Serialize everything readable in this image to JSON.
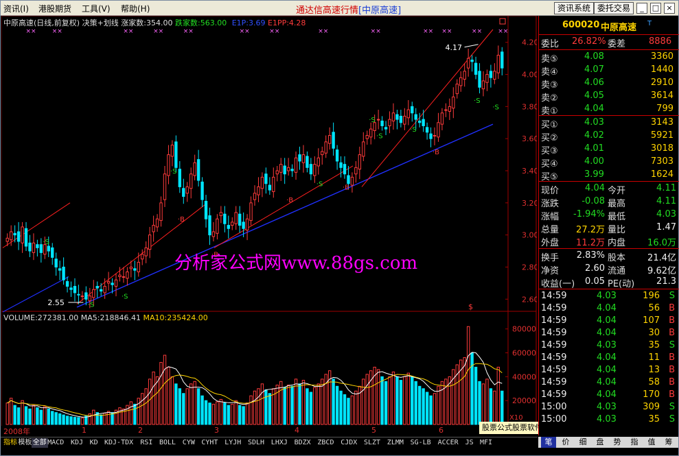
{
  "menu": {
    "items": [
      "资讯(I)",
      "港股期货",
      "工具(V)",
      "帮助(H)"
    ],
    "title": "通达信高速行情",
    "subtitle": "[中原高速]",
    "btn_info": "资讯系统",
    "btn_order": "委托交易",
    "win_min": "_",
    "win_max": "□",
    "win_close": "×"
  },
  "chart_header": {
    "name": "中原高速(日线,前复权)",
    "indicator": "决策+划线",
    "up_count": "涨家数:354.00",
    "down_count": "跌家数:563.00",
    "e1p": "E1P:3.69",
    "e1pp": "E1PP:4.28"
  },
  "volume_header": {
    "volume": "VOLUME:272381.00",
    "ma5": "MA5:218846.41",
    "ma10": "MA10:235424.00"
  },
  "annotations": {
    "high_label": "4.17",
    "low_label": "2.55",
    "watermark": "分析家公式网www.88gs.com",
    "x10": "X10",
    "dollar": "$"
  },
  "timeline": {
    "year": "2008年",
    "months": [
      "1",
      "2",
      "3",
      "4",
      "5",
      "6"
    ]
  },
  "quote": {
    "code": "600020",
    "name": "中原高速",
    "t_mark": "T",
    "weibi_label": "委比",
    "weibi_value": "26.82%",
    "weicha_label": "委差",
    "weicha_value": "8886",
    "sells": [
      {
        "label": "卖⑤",
        "price": "4.08",
        "vol": "3360"
      },
      {
        "label": "卖④",
        "price": "4.07",
        "vol": "1440"
      },
      {
        "label": "卖③",
        "price": "4.06",
        "vol": "2910"
      },
      {
        "label": "卖②",
        "price": "4.05",
        "vol": "3614"
      },
      {
        "label": "卖①",
        "price": "4.04",
        "vol": "799"
      }
    ],
    "buys": [
      {
        "label": "买①",
        "price": "4.03",
        "vol": "3143"
      },
      {
        "label": "买②",
        "price": "4.02",
        "vol": "5921"
      },
      {
        "label": "买③",
        "price": "4.01",
        "vol": "3018"
      },
      {
        "label": "买④",
        "price": "4.00",
        "vol": "7303"
      },
      {
        "label": "买⑤",
        "price": "3.99",
        "vol": "1624"
      }
    ],
    "stats": [
      {
        "l1": "现价",
        "v1": "4.04",
        "l2": "今开",
        "v2": "4.11"
      },
      {
        "l1": "涨跌",
        "v1": "-0.08",
        "l2": "最高",
        "v2": "4.11"
      },
      {
        "l1": "涨幅",
        "v1": "-1.94%",
        "l2": "最低",
        "v2": "4.03"
      },
      {
        "l1": "总量",
        "v1": "27.2万",
        "l2": "量比",
        "v2": "1.47"
      },
      {
        "l1": "外盘",
        "v1": "11.2万",
        "l2": "内盘",
        "v2": "16.0万"
      }
    ],
    "finance": [
      {
        "l1": "换手",
        "v1": "2.83%",
        "l2": "股本",
        "v2": "21.4亿"
      },
      {
        "l1": "净资",
        "v1": "2.60",
        "l2": "流通",
        "v2": "9.62亿"
      },
      {
        "l1": "收益(一)",
        "v1": "0.05",
        "l2": "PE(动)",
        "v2": "21.3"
      }
    ],
    "ticks": [
      {
        "time": "14:59",
        "price": "4.03",
        "vol": "196",
        "side": "S"
      },
      {
        "time": "14:59",
        "price": "4.04",
        "vol": "56",
        "side": "B"
      },
      {
        "time": "14:59",
        "price": "4.04",
        "vol": "107",
        "side": "B"
      },
      {
        "time": "14:59",
        "price": "4.04",
        "vol": "30",
        "side": "B"
      },
      {
        "time": "14:59",
        "price": "4.03",
        "vol": "35",
        "side": "S"
      },
      {
        "time": "14:59",
        "price": "4.04",
        "vol": "11",
        "side": "B"
      },
      {
        "time": "14:59",
        "price": "4.04",
        "vol": "13",
        "side": "B"
      },
      {
        "time": "14:59",
        "price": "4.04",
        "vol": "58",
        "side": "B"
      },
      {
        "time": "14:59",
        "price": "4.04",
        "vol": "170",
        "side": "B"
      },
      {
        "time": "15:00",
        "price": "4.03",
        "vol": "309",
        "side": "S"
      },
      {
        "time": "15:00",
        "price": "4.03",
        "vol": "35",
        "side": "S"
      }
    ]
  },
  "status_bar": "股票公式股票软件下载[分析家公式网www.88gs.com]",
  "bottom_tabs": [
    "指标",
    "模板",
    "全部",
    "MACD",
    "KDJ",
    "KD",
    "KDJ-TDX",
    "RSI",
    "BOLL",
    "CYW",
    "CYHT",
    "LYJH",
    "SDLH",
    "LHXJ",
    "BDZX",
    "ZBCD",
    "CJDX",
    "SLZT",
    "ZLMM",
    "SG-LB",
    "ACCER",
    "JS",
    "MFI"
  ],
  "panel_tabs": [
    "笔",
    "价",
    "细",
    "盘",
    "势",
    "指",
    "值",
    "筹"
  ],
  "colors": {
    "up": "#ff3b3b",
    "down": "#00e5ff",
    "trend_up": "#ff2020",
    "trend_support": "#2030ff",
    "ma5": "#ffffff",
    "ma10": "#ffd400",
    "watermark": "#ff00ff"
  },
  "chart_data": {
    "type": "candlestick",
    "price_axis": {
      "ticks": [
        2.6,
        2.8,
        3.0,
        3.2,
        3.4,
        3.6,
        3.8,
        4.0,
        4.2
      ],
      "range": [
        2.52,
        4.28
      ]
    },
    "volume_axis": {
      "ticks": [
        20000,
        40000,
        60000,
        80000
      ],
      "range": [
        0,
        85000
      ]
    },
    "closes": [
      2.98,
      3.02,
      3.0,
      2.96,
      3.05,
      2.93,
      2.9,
      2.95,
      2.92,
      2.89,
      2.94,
      2.9,
      2.86,
      2.8,
      2.78,
      2.72,
      2.68,
      2.66,
      2.64,
      2.63,
      2.62,
      2.6,
      2.62,
      2.66,
      2.67,
      2.65,
      2.68,
      2.71,
      2.69,
      2.72,
      2.75,
      2.74,
      2.77,
      2.8,
      2.78,
      2.83,
      2.88,
      2.92,
      3.0,
      3.06,
      3.1,
      3.2,
      3.38,
      3.5,
      3.56,
      3.42,
      3.3,
      3.24,
      3.3,
      3.38,
      3.45,
      3.34,
      3.22,
      3.1,
      3.0,
      3.02,
      3.1,
      3.14,
      3.07,
      3.04,
      3.08,
      3.14,
      3.06,
      3.04,
      3.1,
      3.2,
      3.26,
      3.3,
      3.36,
      3.32,
      3.28,
      3.36,
      3.4,
      3.44,
      3.38,
      3.42,
      3.4,
      3.48,
      3.46,
      3.5,
      3.42,
      3.38,
      3.44,
      3.48,
      3.52,
      3.58,
      3.62,
      3.54,
      3.46,
      3.42,
      3.38,
      3.32,
      3.36,
      3.42,
      3.5,
      3.58,
      3.62,
      3.66,
      3.7,
      3.72,
      3.68,
      3.66,
      3.72,
      3.76,
      3.72,
      3.7,
      3.74,
      3.78,
      3.76,
      3.72,
      3.7,
      3.68,
      3.64,
      3.6,
      3.62,
      3.7,
      3.76,
      3.78,
      3.8,
      3.86,
      3.94,
      3.98,
      4.02,
      4.1,
      4.08,
      4.0,
      3.92,
      3.96,
      4.0,
      3.98,
      4.02,
      4.12,
      4.04
    ],
    "volumes": [
      18000,
      22000,
      16000,
      14000,
      20000,
      15000,
      13000,
      16000,
      14000,
      12000,
      15000,
      13000,
      11000,
      10000,
      9000,
      8000,
      7000,
      6500,
      6000,
      5800,
      5500,
      7000,
      9000,
      12000,
      10000,
      8000,
      9500,
      11000,
      10000,
      12000,
      14000,
      13000,
      16000,
      19000,
      17000,
      22000,
      26000,
      30000,
      38000,
      44000,
      40000,
      52000,
      58000,
      48000,
      40000,
      34000,
      30000,
      26000,
      30000,
      34000,
      36000,
      30000,
      24000,
      20000,
      18000,
      17000,
      19000,
      21000,
      18000,
      16000,
      17000,
      20000,
      16000,
      15000,
      18000,
      24000,
      28000,
      30000,
      34000,
      29000,
      26000,
      30000,
      33000,
      36000,
      31000,
      33000,
      32000,
      38000,
      34000,
      37000,
      30000,
      27000,
      31000,
      34000,
      38000,
      42000,
      45000,
      38000,
      32000,
      28000,
      25000,
      22000,
      24000,
      28000,
      32000,
      38000,
      42000,
      45000,
      48000,
      46000,
      40000,
      36000,
      40000,
      44000,
      40000,
      37000,
      40000,
      43000,
      40000,
      36000,
      32000,
      30000,
      27000,
      24000,
      26000,
      32000,
      36000,
      38000,
      40000,
      46000,
      50000,
      54000,
      56000,
      82000,
      60000,
      48000,
      36000,
      34000,
      38000,
      30000,
      28000,
      48000,
      28000
    ]
  }
}
